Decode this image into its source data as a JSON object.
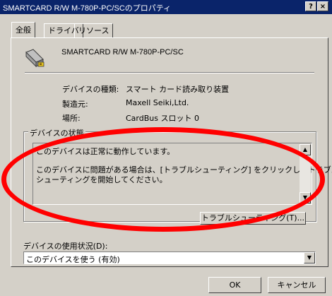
{
  "window": {
    "title": "SMARTCARD R/W M-780P-PC/SCのプロパティ",
    "help_label": "?",
    "close_label": "×"
  },
  "tabs": [
    {
      "label": "全般"
    },
    {
      "label": "ドライバ"
    },
    {
      "label": "リソース"
    }
  ],
  "device": {
    "name": "SMARTCARD R/W M-780P-PC/SC",
    "icon": "smartcard-reader-icon"
  },
  "properties": [
    {
      "label": "デバイスの種類:",
      "value": "スマート カード読み取り装置"
    },
    {
      "label": "製造元:",
      "value": "Maxell Seiki,Ltd."
    },
    {
      "label": "場所:",
      "value": "CardBus スロット 0"
    }
  ],
  "status": {
    "group_label": "デバイスの状態",
    "lines": [
      "このデバイスは正常に動作しています。",
      "",
      "このデバイスに問題がある場合は、[トラブルシューティング] をクリックしてトラブル",
      "シューティングを開始してください。"
    ],
    "troubleshoot_label": "トラブルシューティング(T)..."
  },
  "usage": {
    "label": "デバイスの使用状況(D):",
    "selected": "このデバイスを使う (有効)"
  },
  "buttons": {
    "ok": "OK",
    "cancel": "キャンセル"
  },
  "colors": {
    "titlebar": "#0a246a",
    "face": "#d4d0c8",
    "annotation": "#ff0000"
  }
}
